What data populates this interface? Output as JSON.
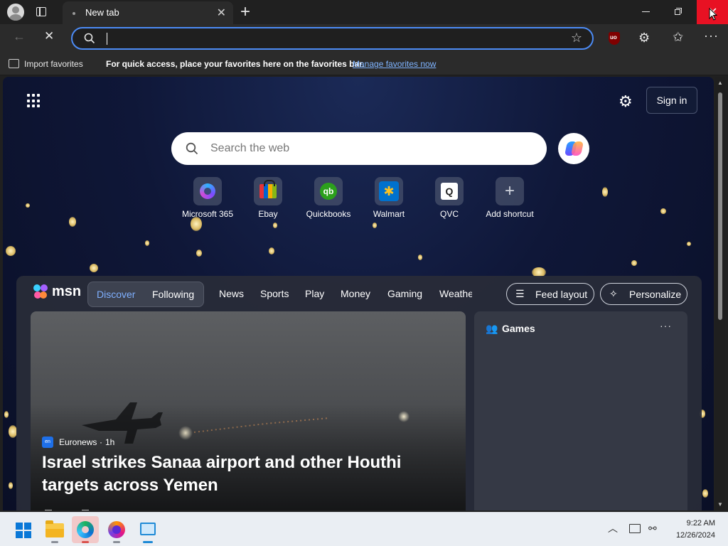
{
  "browser": {
    "tab_title": "New tab",
    "tab_close": "✕",
    "new_tab": "+",
    "window_controls": {
      "minimize": "",
      "restore": "",
      "close": "✕"
    },
    "address_bar": {
      "value": "",
      "placeholder": ""
    }
  },
  "favorites_bar": {
    "import_label": "Import favorites",
    "message": "For quick access, place your favorites here on the favorites bar.",
    "link": "Manage favorites now"
  },
  "newtab": {
    "signin": "Sign in",
    "search_placeholder": "Search the web",
    "shortcuts": [
      {
        "label": "Microsoft 365",
        "icon": "microsoft-365-icon"
      },
      {
        "label": "Ebay",
        "icon": "ebay-icon"
      },
      {
        "label": "Quickbooks",
        "icon": "quickbooks-icon",
        "glyph": "qb"
      },
      {
        "label": "Walmart",
        "icon": "walmart-icon",
        "glyph": "✱"
      },
      {
        "label": "QVC",
        "icon": "qvc-icon",
        "glyph": "Q"
      },
      {
        "label": "Add shortcut",
        "icon": "plus-icon",
        "glyph": "+"
      }
    ]
  },
  "feed": {
    "logo": "msn",
    "tabs": [
      "Discover",
      "Following"
    ],
    "nav": [
      "News",
      "Sports",
      "Play",
      "Money",
      "Gaming",
      "Weathe"
    ],
    "feed_layout": "Feed layout",
    "personalize": "Personalize",
    "hero": {
      "source": "Euronews",
      "source_badge": "en",
      "separator": "·",
      "time": "1h",
      "headline": "Israel strikes Sanaa airport and other Houthi targets across Yemen"
    },
    "games": {
      "title": "Games",
      "more": "···"
    }
  },
  "taskbar": {
    "time": "9:22 AM",
    "date": "12/26/2024"
  },
  "colors": {
    "accent": "#4c8bf5",
    "close_red": "#e81123",
    "link": "#7fb4ff",
    "discover_tab": "#7fb0ff"
  }
}
